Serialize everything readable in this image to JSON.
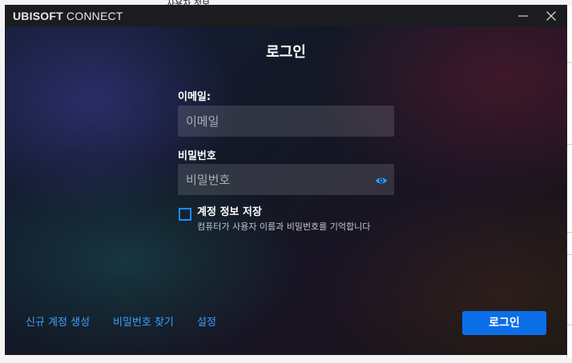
{
  "background": {
    "top_text": "사용자 정보"
  },
  "window": {
    "app_title_bold": "UBISOFT",
    "app_title_rest": " CONNECT",
    "heading": "로그인"
  },
  "form": {
    "email_label": "이메일:",
    "email_placeholder": "이메일",
    "email_value": "",
    "password_label": "비밀번호",
    "password_placeholder": "비밀번호",
    "password_value": "",
    "remember_label": "계정 정보 저장",
    "remember_hint": "컴퓨터가 사용자 이름과 비밀번호를 기억합니다",
    "remember_checked": false
  },
  "footer": {
    "create_account": "신규 계정 생성",
    "forgot_password": "비밀번호 찾기",
    "settings": "설정",
    "login_button": "로그인"
  },
  "colors": {
    "accent": "#0b6ee8",
    "link": "#3aa0ff",
    "checkbox_border": "#1a8cff"
  },
  "icons": [
    "minimize-icon",
    "close-icon",
    "eye-icon"
  ]
}
